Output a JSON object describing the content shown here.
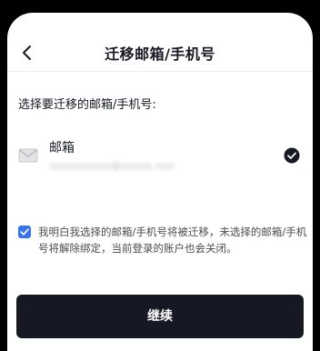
{
  "header": {
    "title": "迁移邮箱/手机号"
  },
  "main": {
    "prompt": "选择要迁移的邮箱/手机号:",
    "option": {
      "label": "邮箱",
      "value": "xxxxxxxxxx@xxxxx.xxx",
      "selected": true,
      "icon": "mail-icon"
    },
    "consent": {
      "checked": true,
      "text": "我明白我选择的邮箱/手机号将被迁移，未选择的邮箱/手机号将解除绑定，当前登录的账户也会关闭。"
    },
    "continue_label": "继续"
  },
  "colors": {
    "accent": "#3b73e8",
    "button": "#161823",
    "text": "#161823"
  }
}
